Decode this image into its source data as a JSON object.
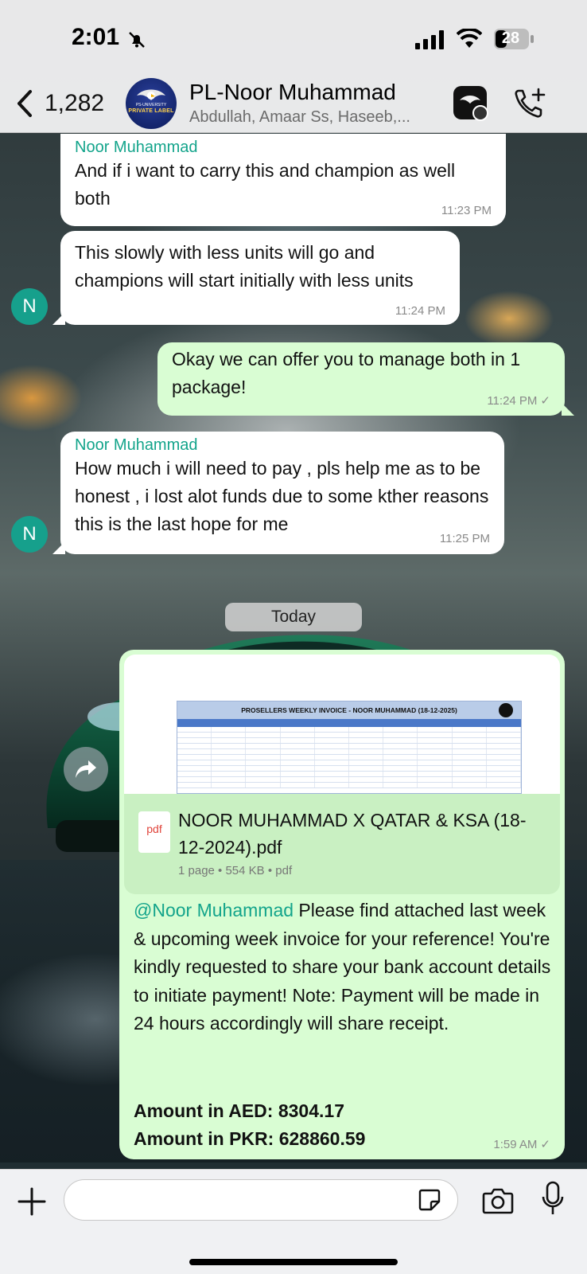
{
  "status_bar": {
    "time": "2:01",
    "battery": "28"
  },
  "header": {
    "back_count": "1,282",
    "title": "PL-Noor Muhammad",
    "subtitle": "Abdullah, Amaar Ss, Haseeb,...",
    "avatar_text": "PRIVATE LABEL",
    "avatar_subtext": "PS-UNIVERSITY"
  },
  "messages": [
    {
      "direction": "incoming",
      "sender": "Noor Muhammad",
      "text": "And if i want to carry this and champion as well both",
      "time": "11:23 PM"
    },
    {
      "direction": "incoming",
      "sender": "",
      "text": "This slowly with less units will go and champions will start initially with less units",
      "time": "11:24 PM",
      "avatar": "N"
    },
    {
      "direction": "outgoing",
      "text": "Okay we can offer you to manage both in 1 package!",
      "time": "11:24 PM",
      "tick": "✓"
    },
    {
      "direction": "incoming",
      "sender": "Noor Muhammad",
      "text": "How much i will need to pay , pls help me as to be honest , i lost alot funds due to some kther reasons this is the last hope for me",
      "time": "11:25 PM",
      "avatar": "N"
    }
  ],
  "date_divider": "Today",
  "document_message": {
    "preview_title": "PROSELLERS WEEKLY INVOICE - NOOR MUHAMMAD (18-12-2025)",
    "file_icon": "pdf",
    "file_name": "NOOR MUHAMMAD X QATAR & KSA  (18-12-2024).pdf",
    "file_meta": "1 page • 554 KB • pdf",
    "mention": "@Noor Muhammad",
    "caption": " Please find attached last week & upcoming week invoice for your reference! You're kindly requested to share your bank account details to initiate payment! Note: Payment will be made in 24 hours accordingly will share receipt.",
    "amount_aed": "Amount in AED: 8304.17",
    "amount_pkr": "Amount in PKR: 628860.59",
    "time": "1:59 AM",
    "tick": "✓"
  },
  "composer": {
    "placeholder": ""
  }
}
